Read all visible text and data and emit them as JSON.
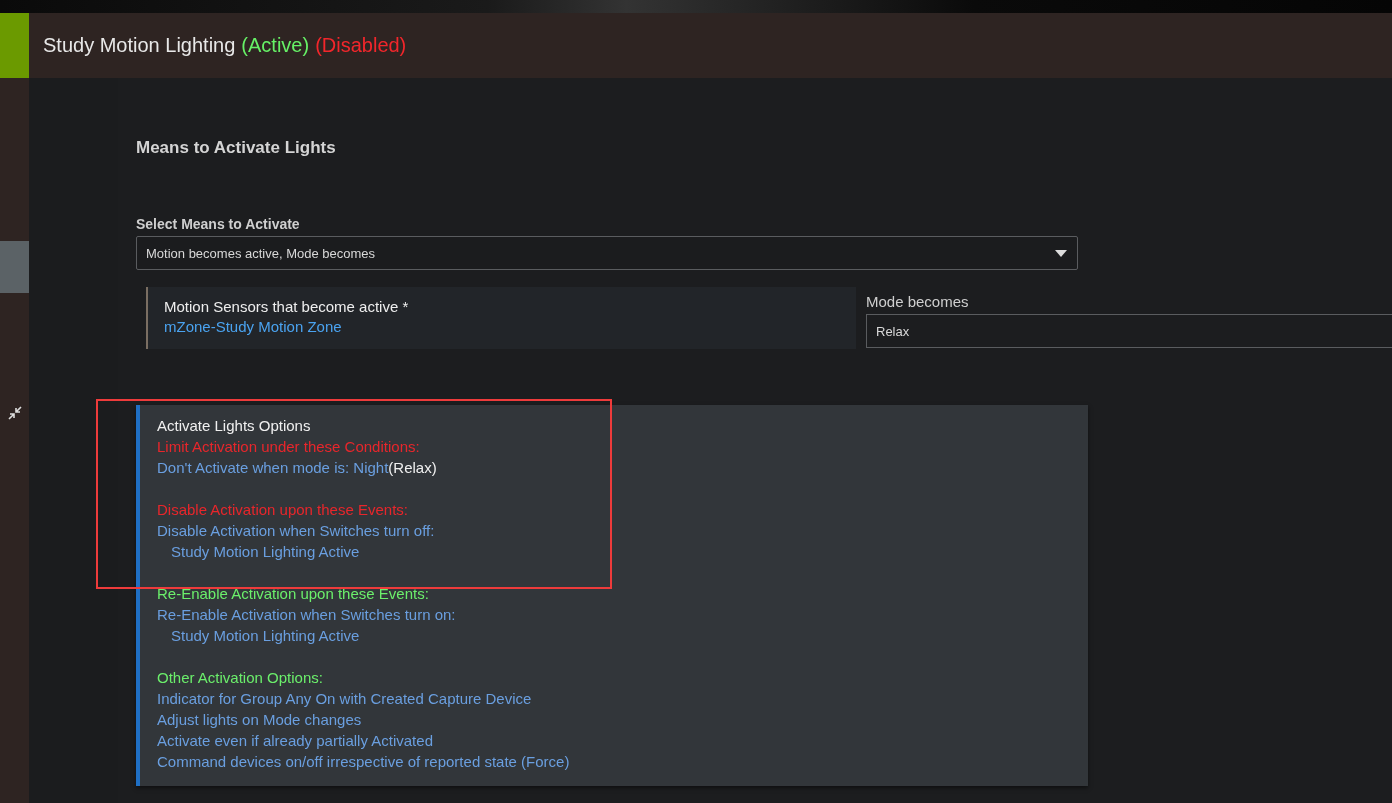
{
  "header": {
    "title": "Study Motion Lighting",
    "active_tag": "(Active)",
    "disabled_tag": "(Disabled)"
  },
  "section_title": "Means to Activate Lights",
  "select": {
    "label": "Select Means to Activate",
    "value": "Motion becomes active, Mode becomes"
  },
  "sensors": {
    "label": "Motion Sensors that become active *",
    "value": "mZone-Study Motion Zone"
  },
  "mode": {
    "label": "Mode becomes",
    "value": "Relax"
  },
  "options": {
    "title": "Activate Lights Options",
    "groups": [
      {
        "heading": "Limit Activation under these Conditions:",
        "kind": "limit",
        "annotated": true,
        "items": [
          {
            "text": "Don't Activate when mode is: Night",
            "note": "(Relax)"
          }
        ]
      },
      {
        "heading": "Disable Activation upon these Events:",
        "kind": "limit",
        "annotated": true,
        "items": [
          {
            "text": "Disable Activation when Switches turn off:",
            "children": [
              {
                "text": "Study Motion Lighting Active"
              }
            ]
          }
        ]
      },
      {
        "heading": "Re-Enable Activation upon these Events:",
        "kind": "enable",
        "annotated": false,
        "items": [
          {
            "text": "Re-Enable Activation when Switches turn on:",
            "children": [
              {
                "text": "Study Motion Lighting Active"
              }
            ]
          }
        ]
      },
      {
        "heading": "Other Activation Options:",
        "kind": "enable",
        "annotated": false,
        "items": [
          {
            "text": "Indicator for Group Any On with Created Capture Device"
          },
          {
            "text": "Adjust lights on Mode changes"
          },
          {
            "text": "Activate even if already partially Activated"
          },
          {
            "text": "Command devices on/off irrespective of reported state (Force)"
          }
        ]
      }
    ]
  }
}
